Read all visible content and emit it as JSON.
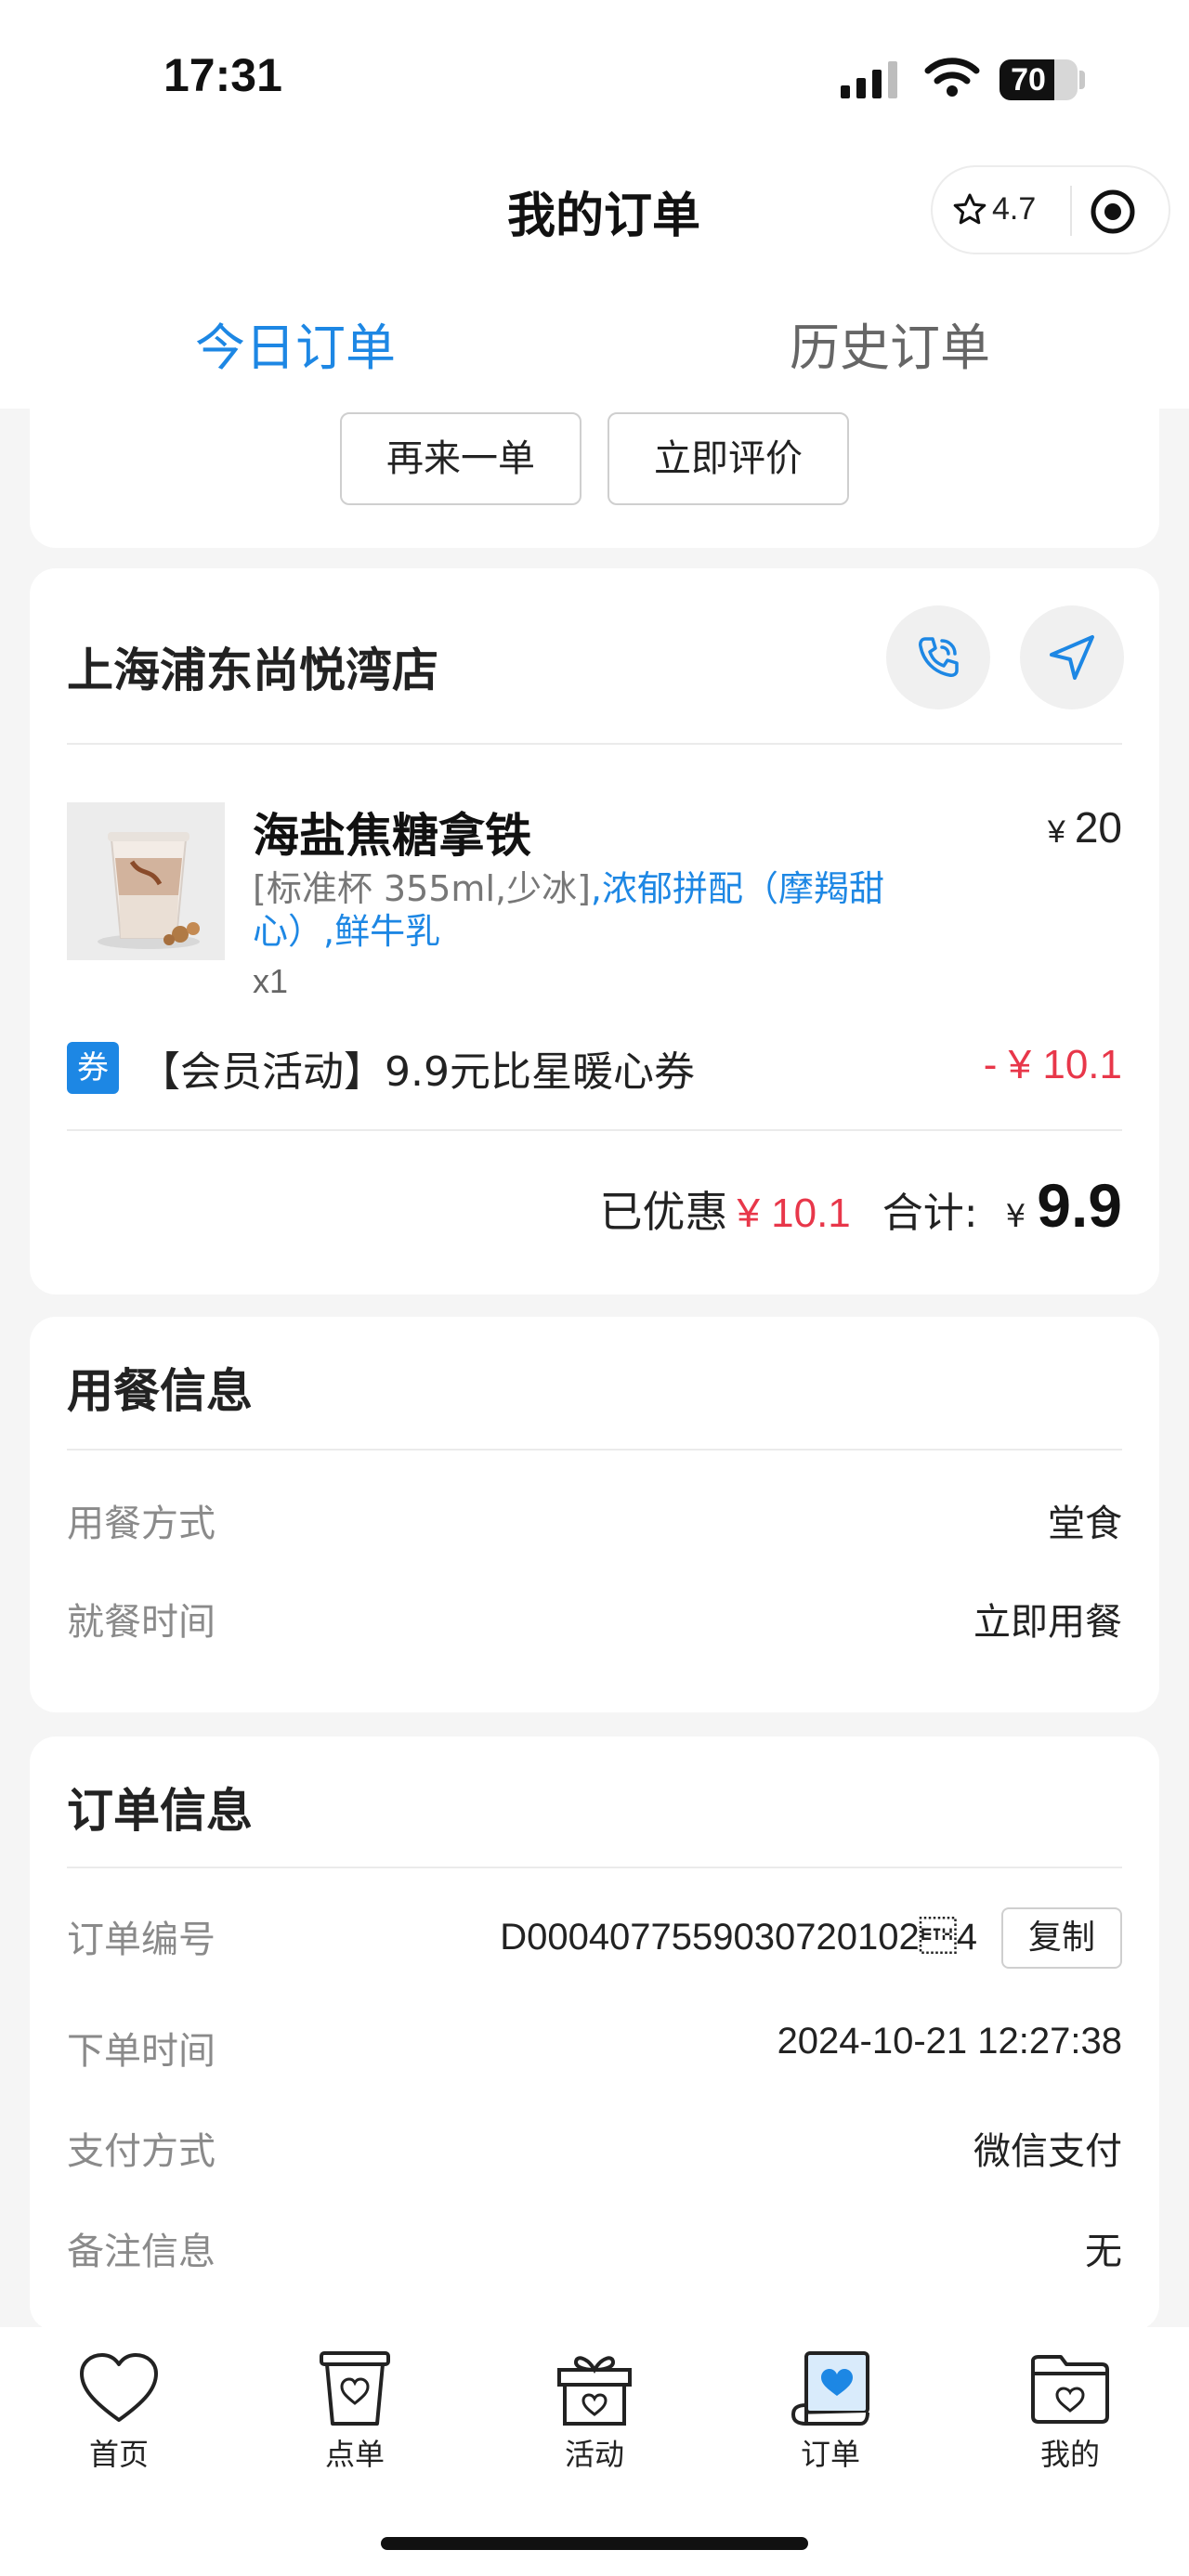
{
  "status_bar": {
    "time": "17:31",
    "battery": "70",
    "battery_level": 0.7
  },
  "header": {
    "title": "我的订单",
    "rating": "4.7",
    "star_icon": "star-outline-icon",
    "target_icon": "target-icon"
  },
  "tabs": [
    {
      "label": "今日订单",
      "active": true
    },
    {
      "label": "历史订单",
      "active": false
    }
  ],
  "actions": {
    "reorder": "再来一单",
    "review": "立即评价"
  },
  "order": {
    "store_name": "上海浦东尚悦湾店",
    "call_icon": "phone-icon",
    "navigate_icon": "navigate-arrow-icon",
    "item": {
      "name": "海盐焦糖拿铁",
      "price_symbol": "¥",
      "price": "20",
      "spec_grey": "[标准杯 355ml,少冰]",
      "spec_blue": ",浓郁拼配（摩羯甜心）,鲜牛乳",
      "quantity": "x1"
    },
    "coupon": {
      "badge": "券",
      "text": "【会员活动】9.9元比星暖心券",
      "amount": "- ¥ 10.1"
    },
    "summary": {
      "saved_label": "已优惠",
      "saved_amount": "¥ 10.1",
      "total_label": "合计:",
      "total_symbol": "¥",
      "total": "9.9"
    }
  },
  "dining": {
    "title": "用餐信息",
    "rows": [
      {
        "label": "用餐方式",
        "value": "堂食"
      },
      {
        "label": "就餐时间",
        "value": "立即用餐"
      }
    ]
  },
  "order_info": {
    "title": "订单信息",
    "copy_label": "复制",
    "rows": [
      {
        "label": "订单编号",
        "value": "D0004077559030720102\u00034"
      },
      {
        "label": "下单时间",
        "value": "2024-10-21 12:27:38"
      },
      {
        "label": "支付方式",
        "value": "微信支付"
      },
      {
        "label": "备注信息",
        "value": "无"
      }
    ]
  },
  "tabbar": [
    {
      "label": "首页",
      "icon": "heart-icon"
    },
    {
      "label": "点单",
      "icon": "cup-icon"
    },
    {
      "label": "活动",
      "icon": "gift-icon"
    },
    {
      "label": "订单",
      "icon": "order-scroll-icon",
      "active": true
    },
    {
      "label": "我的",
      "icon": "folder-icon"
    }
  ],
  "colors": {
    "accent": "#1d87e4",
    "discount": "#e8374a",
    "background": "#f5f5f5"
  }
}
